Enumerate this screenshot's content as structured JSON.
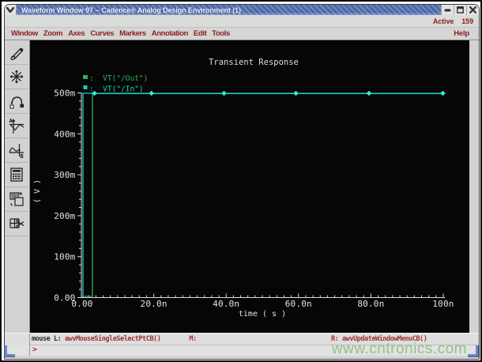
{
  "window": {
    "title": "Waveform Window 97 -- Cadence® Analog Design Environment (1)",
    "controls": {
      "menu_icon": "chevron-down",
      "minimize_icon": "minimize-dash",
      "maximize_icon": "maximize-square",
      "close_icon": "close-x"
    }
  },
  "active_indicator": {
    "label": "Active",
    "count": "159"
  },
  "menu_bar": {
    "items": [
      "Window",
      "Zoom",
      "Axes",
      "Curves",
      "Markers",
      "Annotation",
      "Edit",
      "Tools"
    ],
    "help": "Help"
  },
  "side_toolbar": {
    "icons": [
      "pen-marker",
      "asterisk-star",
      "arc-hop",
      "axis-waveform",
      "sine-wave-b",
      "calculator",
      "copy-windows",
      "cut-window"
    ]
  },
  "status_bar": {
    "mouse_label": "mouse L:",
    "left_binding": "awvMouseSingleSelectPtCB()",
    "middle_label": "M:",
    "right_label": "R:",
    "right_binding": "awvUpdateWindowMenuCB()"
  },
  "prompt": ">",
  "watermark": "www.cntronics.com",
  "colors": {
    "titlebar_blue": "#4c69ab",
    "menu_text_red": "#8b1f1f",
    "plot_background": "#060607",
    "axis_white": "#d9d9d9",
    "out_green": "#2fae5e",
    "in_cyan": "#17ccc6",
    "marker_cyan": "#3ce9d4",
    "watermark_green": "#8cbe7c"
  },
  "chart_data": {
    "type": "line",
    "title": "Transient Response",
    "xlabel": "time ( s )",
    "ylabel": "( V )",
    "x_ticks": [
      "0.00",
      "20.0n",
      "40.0n",
      "60.0n",
      "80.0n",
      "100n"
    ],
    "y_ticks": [
      "0.00",
      "100m",
      "200m",
      "300m",
      "400m",
      "500m"
    ],
    "xlim_seconds": [
      0,
      1e-07
    ],
    "ylim_volts": [
      0,
      0.5
    ],
    "grid": false,
    "legend_position": "top-left",
    "axes_layout": {
      "x_minor_divisions": 50,
      "y_minor_divisions": 25,
      "x_major_every": 10,
      "y_major_every": 5
    },
    "series": [
      {
        "name": "VT(\"/Out\")",
        "legend_text": ":  VT(\"/Out\")",
        "color": "#2fae5e",
        "marker": "square",
        "x_ns": [
          0,
          3,
          3,
          100
        ],
        "y_V": [
          0,
          0,
          0.5,
          0.5
        ]
      },
      {
        "name": "VT(\"/In\")",
        "legend_text": ":  VT(\"/In\")",
        "color": "#17ccc6",
        "marker": "diamond",
        "marker_color": "#3ce9d4",
        "x_ns": [
          0,
          0.4,
          0.4,
          100
        ],
        "y_V": [
          0,
          0,
          0.5,
          0.5
        ],
        "marker_x_ns": [
          3.5,
          19.5,
          39.5,
          59.5,
          79.5,
          100
        ]
      }
    ]
  }
}
